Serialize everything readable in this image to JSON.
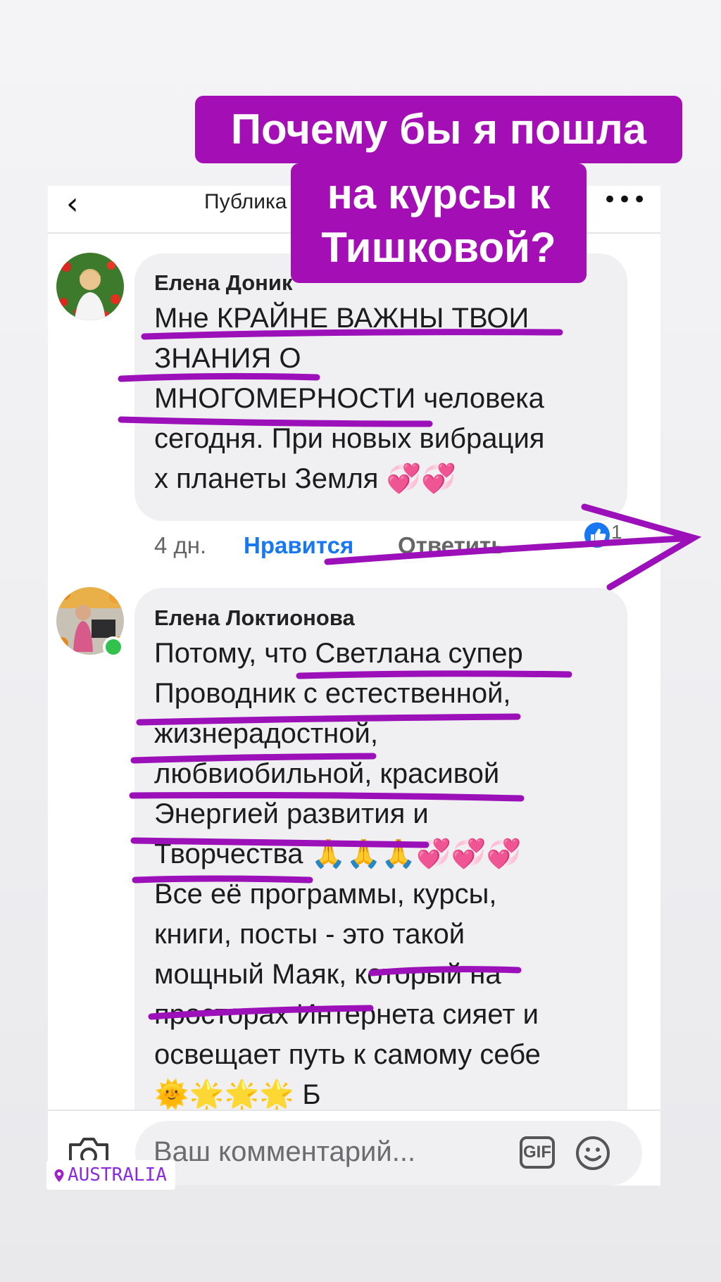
{
  "headline": {
    "line1": "Почему бы я пошла",
    "line2": "на курсы к",
    "line3": "Тишковой?",
    "bg_color": "#a30eb5"
  },
  "topbar": {
    "back_icon": "chevron-left-icon",
    "title": "Публика",
    "more_icon": "more-dots-icon"
  },
  "comments": [
    {
      "author": "Елена Доник",
      "text": "Мне КРАЙНЕ ВАЖНЫ ТВОИ\nЗНАНИЯ О\nМНОГОМЕРНОСТИ человека\nсегодня. При новых вибрация\nх планеты Земля 💞💞",
      "time": "4 дн.",
      "like_label": "Нравится",
      "reply_label": "Ответить",
      "like_count": "1"
    },
    {
      "author": "Елена Локтионова",
      "text": "Потому, что Светлана супер\nПроводник с естественной,\nжизнерадостной,\nлюбвиобильной, красивой\nЭнергией развития и\nТворчества 🙏🙏🙏💞💞💞\nВсе её программы, курсы,\nкниги, посты - это такой\nмощный Маяк, который на\nпросторах Интернета сияет и\nосвещает путь к самому себе\n🌞🌟🌟🌟 Б",
      "online": true
    }
  ],
  "composer": {
    "camera_icon": "camera-icon",
    "placeholder": "Ваш комментарий...",
    "gif_label": "GIF",
    "emoji_icon": "smiley-icon"
  },
  "location_sticker": {
    "pin_icon": "location-pin-icon",
    "label": "AUSTRALIA"
  },
  "colors": {
    "accent_blue": "#1877f2",
    "marker_purple": "#9b10b8",
    "online_green": "#31c24e"
  }
}
